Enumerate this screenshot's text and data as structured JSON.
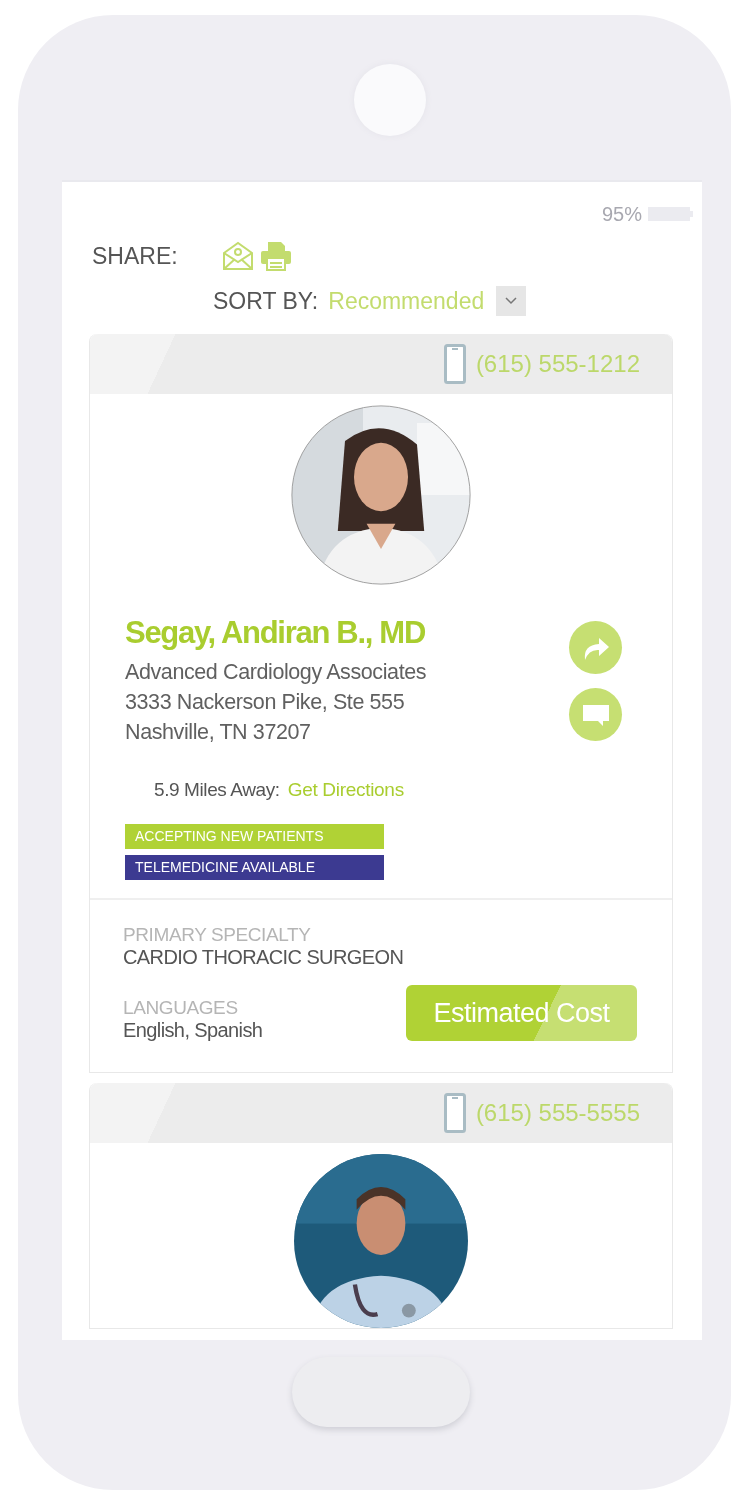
{
  "status_bar": {
    "battery": "95%"
  },
  "share": {
    "label": "SHARE:"
  },
  "sort": {
    "label": "SORT BY:",
    "value": "Recommended"
  },
  "providers": [
    {
      "phone": "(615) 555-1212",
      "name": "Segay, Andiran B., MD",
      "practice": "Advanced Cardiology Associates",
      "address_lines": [
        "3333 Nackerson Pike, Ste 555",
        "Nashville, TN 37207"
      ],
      "distance": "5.9 Miles Away:",
      "directions_link": "Get Directions",
      "badges": [
        {
          "text": "ACCEPTING NEW PATIENTS",
          "color": "#b0d235"
        },
        {
          "text": "TELEMEDICINE AVAILABLE",
          "color": "#3c3a91"
        }
      ],
      "details": [
        {
          "label": "PRIMARY SPECIALTY",
          "value": "CARDIO THORACIC SURGEON"
        },
        {
          "label": "LANGUAGES",
          "value": "English, Spanish"
        }
      ],
      "cost_button": "Estimated Cost"
    },
    {
      "phone": "(615) 555-5555"
    }
  ]
}
